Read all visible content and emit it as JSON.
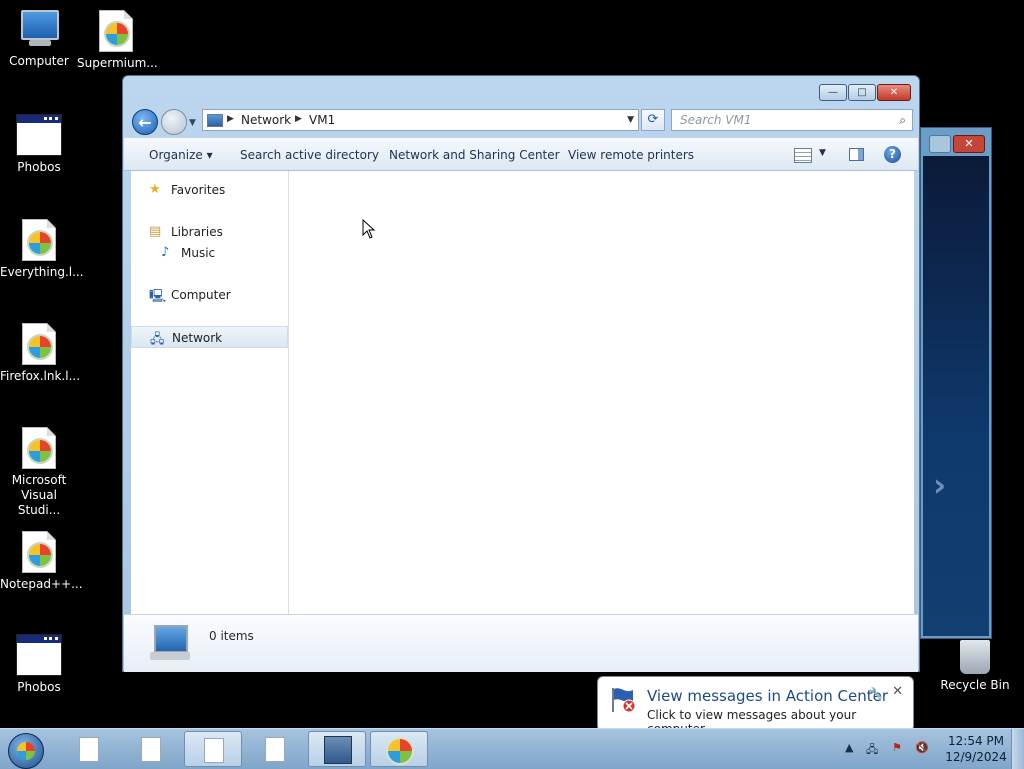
{
  "desktop": {
    "icons": [
      {
        "label": "Computer",
        "icon": "computer-icon"
      },
      {
        "label": "Supermium...",
        "icon": "browser-shortcut-icon"
      },
      {
        "label": "Phobos",
        "icon": "application-window-icon"
      },
      {
        "label": "Everything.l...",
        "icon": "browser-shortcut-icon"
      },
      {
        "label": "Firefox.lnk.l...",
        "icon": "browser-shortcut-icon"
      },
      {
        "label": "Microsoft Visual Studi...",
        "icon": "browser-shortcut-icon"
      },
      {
        "label": "Notepad++...",
        "icon": "browser-shortcut-icon"
      },
      {
        "label": "Phobos",
        "icon": "application-window-icon"
      },
      {
        "label": "Recycle Bin",
        "icon": "recycle-bin-icon"
      }
    ]
  },
  "explorer": {
    "buttons": {
      "minimize": "—",
      "maximize": "□",
      "close": "✕"
    },
    "address": {
      "crumbs": [
        "Network",
        "VM1"
      ]
    },
    "search": {
      "placeholder": "Search VM1"
    },
    "commands": [
      "Organize",
      "Search active directory",
      "Network and Sharing Center",
      "View remote printers"
    ],
    "nav": {
      "items": [
        {
          "label": "Favorites",
          "icon": "star-icon"
        },
        {
          "label": "Libraries",
          "icon": "libraries-icon"
        },
        {
          "label": "Music",
          "icon": "music-icon"
        },
        {
          "label": "Computer",
          "icon": "computer-icon"
        },
        {
          "label": "Network",
          "icon": "network-icon",
          "selected": true
        }
      ]
    },
    "details": {
      "count": "0 items"
    }
  },
  "notification": {
    "title": "View messages in Action Center",
    "text": "Click to view messages about your computer."
  },
  "taskbar": {
    "clock": {
      "time": "12:54 PM",
      "date": "12/9/2024"
    }
  }
}
